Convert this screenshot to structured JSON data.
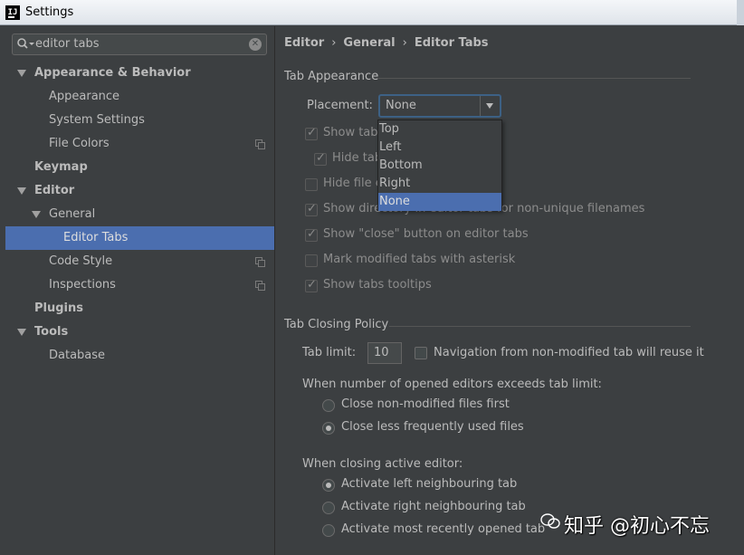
{
  "window": {
    "title": "Settings",
    "app_icon_text": "IJ"
  },
  "search": {
    "value": "editor tabs"
  },
  "sidebar": {
    "items": [
      {
        "label": "Appearance & Behavior"
      },
      {
        "label": "Appearance"
      },
      {
        "label": "System Settings"
      },
      {
        "label": "File Colors"
      },
      {
        "label": "Keymap"
      },
      {
        "label": "Editor"
      },
      {
        "label": "General"
      },
      {
        "label": "Editor Tabs"
      },
      {
        "label": "Code Style"
      },
      {
        "label": "Inspections"
      },
      {
        "label": "Plugins"
      },
      {
        "label": "Tools"
      },
      {
        "label": "Database"
      }
    ]
  },
  "breadcrumb": {
    "items": [
      "Editor",
      "General",
      "Editor Tabs"
    ],
    "separator": "›"
  },
  "tab_appearance": {
    "title": "Tab Appearance",
    "placement_label": "Placement:",
    "placement_value": "None",
    "placement_options": [
      "Top",
      "Left",
      "Bottom",
      "Right",
      "None"
    ],
    "checkboxes": [
      {
        "label": "Show tab",
        "checked": true,
        "enabled": false
      },
      {
        "label": "Hide tab",
        "checked": true,
        "enabled": false
      },
      {
        "label": "Hide file e",
        "checked": false,
        "enabled": false
      },
      {
        "label": "Show directory in editor tabs for non-unique filenames",
        "checked": true,
        "enabled": false
      },
      {
        "label": "Show \"close\" button on editor tabs",
        "checked": true,
        "enabled": false
      },
      {
        "label": "Mark modified tabs with asterisk",
        "checked": false,
        "enabled": false
      },
      {
        "label": "Show tabs tooltips",
        "checked": true,
        "enabled": false
      }
    ]
  },
  "tab_closing": {
    "title": "Tab Closing Policy",
    "tab_limit_label": "Tab limit:",
    "tab_limit_value": "10",
    "reuse_label": "Navigation from non-modified tab will reuse it",
    "exceeds_label": "When number of opened editors exceeds tab limit:",
    "exceeds_options": [
      {
        "label": "Close non-modified files first",
        "selected": false
      },
      {
        "label": "Close less frequently used files",
        "selected": true
      }
    ],
    "closing_label": "When closing active editor:",
    "closing_options": [
      {
        "label": "Activate left neighbouring tab",
        "selected": true
      },
      {
        "label": "Activate right neighbouring tab",
        "selected": false
      },
      {
        "label": "Activate most recently opened tab",
        "selected": false
      }
    ]
  },
  "watermark": {
    "text": "知乎 @初心不忘"
  },
  "colors": {
    "background": "#3c3f41",
    "selection": "#4b6eaf",
    "text": "#bbbbbb",
    "focus_border": "#3d6185"
  }
}
